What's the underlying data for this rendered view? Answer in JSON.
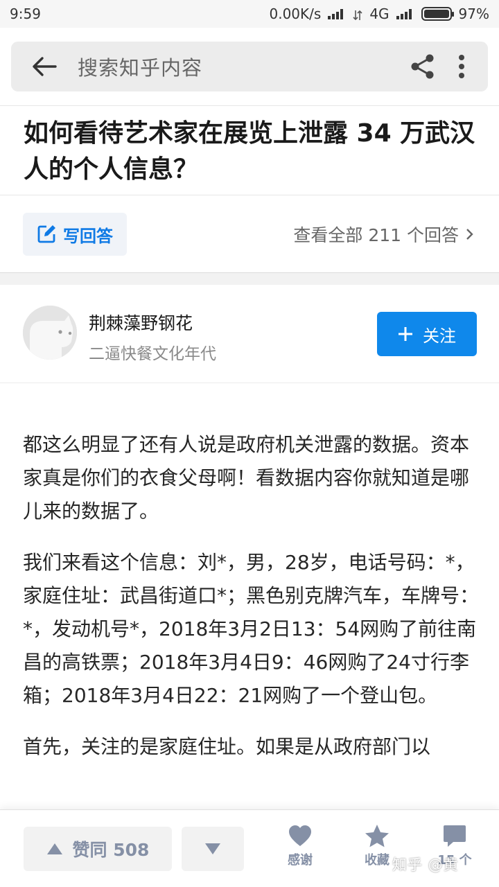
{
  "status_bar": {
    "time": "9:59",
    "net_speed": "0.00K/s",
    "network": "4G",
    "battery": "97%"
  },
  "search": {
    "placeholder": "搜索知乎内容"
  },
  "question": {
    "title": "如何看待艺术家在展览上泄露 34 万武汉人的个人信息？"
  },
  "actions": {
    "write_answer": "写回答",
    "view_all_answers": "查看全部 211 个回答"
  },
  "author": {
    "name": "荆棘藻野钢花",
    "bio": "二逼快餐文化年代",
    "follow_label": "关注"
  },
  "answer": {
    "paragraphs": [
      "都这么明显了还有人说是政府机关泄露的数据。资本家真是你们的衣食父母啊！看数据内容你就知道是哪儿来的数据了。",
      "我们来看这个信息：刘*，男，28岁，电话号码：*，家庭住址：武昌街道口*；黑色别克牌汽车，车牌号：*，发动机号*，2018年3月2日13：54网购了前往南昌的高铁票；2018年3月4日9：46网购了24寸行李箱；2018年3月4日22：21网购了一个登山包。",
      "首先，关注的是家庭住址。如果是从政府部门以"
    ]
  },
  "bottom_bar": {
    "upvote_label": "赞同 508",
    "thanks_label": "感谢",
    "collect_label": "收藏",
    "comments_label": "15 个",
    "watermark": "知乎 @黄"
  },
  "colors": {
    "accent": "#0f88eb",
    "link": "#0f7ae5",
    "muted": "#8590a6"
  }
}
